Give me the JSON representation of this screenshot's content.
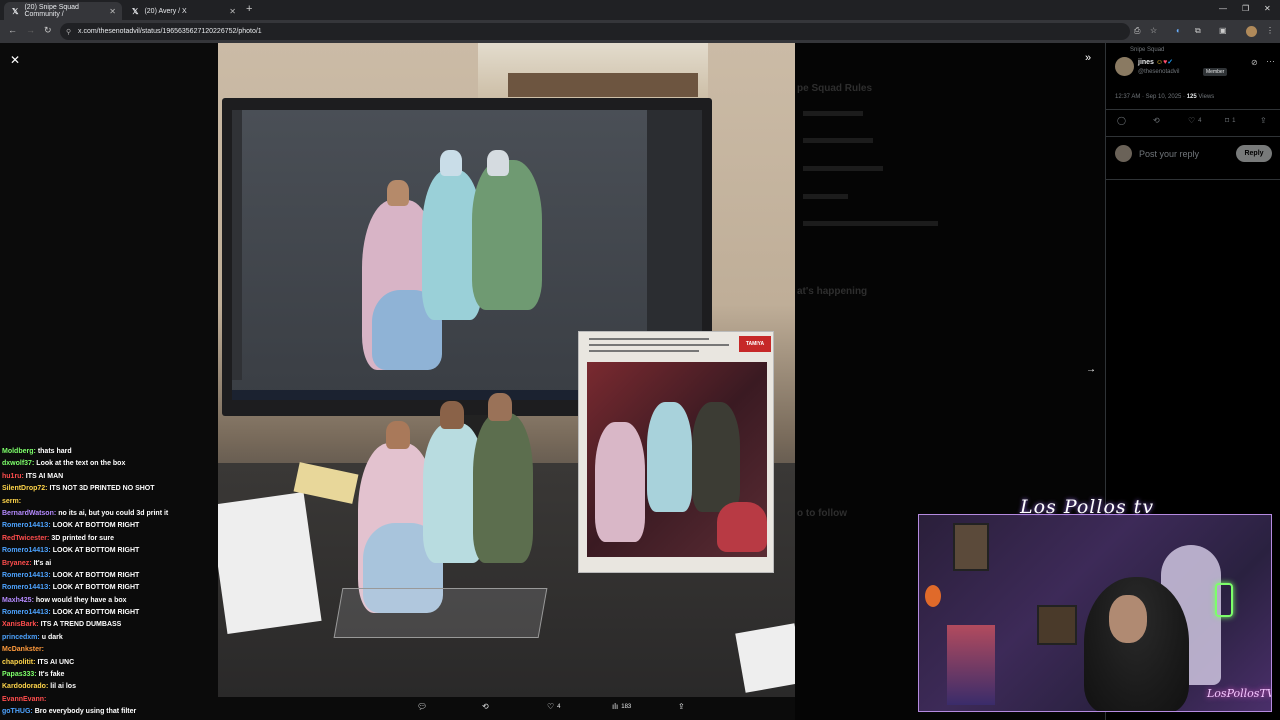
{
  "browser": {
    "tabs": [
      {
        "label": "(20) Snipe Squad Community /",
        "active": true
      },
      {
        "label": "(20) Avery / X",
        "active": false
      }
    ],
    "url": "x.com/thesenotadvil/status/1965635627120226752/photo/1"
  },
  "post": {
    "community": "Snipe Squad",
    "author_name": "jines",
    "author_handle": "@thesenotadvil",
    "member_badge": "Member",
    "timestamp": "12:37 AM · Sep 10, 2025 ·",
    "views_count": "125",
    "views_label": "Views",
    "likes": "4",
    "bookmarks": "1",
    "reply_placeholder": "Post your reply",
    "reply_button": "Reply"
  },
  "photo_actions": {
    "likes": "4",
    "views": "183"
  },
  "photo": {
    "box_brand": "TAMIYA"
  },
  "background_panel": {
    "heading1": "pe Squad Rules",
    "heading2": "at's happening",
    "heading3": "o to follow"
  },
  "chat": [
    {
      "user": "Moldberg:",
      "msg": "thats hard",
      "color": "#7dff6a"
    },
    {
      "user": "dxwolf37:",
      "msg": "Look at the text on the box",
      "color": "#7dff6a"
    },
    {
      "user": "hu1ru:",
      "msg": "ITS AI MAN",
      "color": "#ff4d4d"
    },
    {
      "user": "SilentDrop72:",
      "msg": "ITS NOT 3D PRINTED NO SHOT",
      "color": "#ffd54a"
    },
    {
      "user": "serm:",
      "msg": "",
      "color": "#ffd54a"
    },
    {
      "user": "BernardWatson:",
      "msg": "no its ai, but you could 3d print it",
      "color": "#b58aff"
    },
    {
      "user": "Romero1441З:",
      "msg": "LOOK AT BOTTOM RIGHT",
      "color": "#4da3ff"
    },
    {
      "user": "RedTwicester:",
      "msg": "3D printed for sure",
      "color": "#ff4d4d"
    },
    {
      "user": "Romero1441З:",
      "msg": "LOOK AT BOTTOM RIGHT",
      "color": "#4da3ff"
    },
    {
      "user": "Bryanez:",
      "msg": "It's ai",
      "color": "#ff4d4d"
    },
    {
      "user": "Romero1441З:",
      "msg": "LOOK AT BOTTOM RIGHT",
      "color": "#4da3ff"
    },
    {
      "user": "Romero1441З:",
      "msg": "LOOK AT BOTTOM RIGHT",
      "color": "#4da3ff"
    },
    {
      "user": "Maxh425:",
      "msg": "how would they have a box",
      "color": "#b58aff"
    },
    {
      "user": "Romero1441З:",
      "msg": "LOOK AT BOTTOM RIGHT",
      "color": "#4da3ff"
    },
    {
      "user": "XanisBark:",
      "msg": "ITS A TREND DUMBASS",
      "color": "#ff4d4d"
    },
    {
      "user": "princedxm:",
      "msg": "u dark",
      "color": "#4da3ff"
    },
    {
      "user": "McDankster:",
      "msg": "",
      "color": "#ff9a3c"
    },
    {
      "user": "chapolitit:",
      "msg": "ITS AI UNC",
      "color": "#ffd54a"
    },
    {
      "user": "Papas333:",
      "msg": "It's fake",
      "color": "#7dff6a"
    },
    {
      "user": "Kardodorado:",
      "msg": "lil ai los",
      "color": "#ffd54a"
    },
    {
      "user": "EvannEvann:",
      "msg": "",
      "color": "#ff4d4d"
    },
    {
      "user": "goTHUG:",
      "msg": "Bro everybody using that filter",
      "color": "#4da3ff"
    }
  ],
  "webcam": {
    "logo": "Los Pollos tv"
  },
  "colors": {
    "accent": "#1d9bf0",
    "background": "#000000",
    "muted": "#71767b"
  }
}
